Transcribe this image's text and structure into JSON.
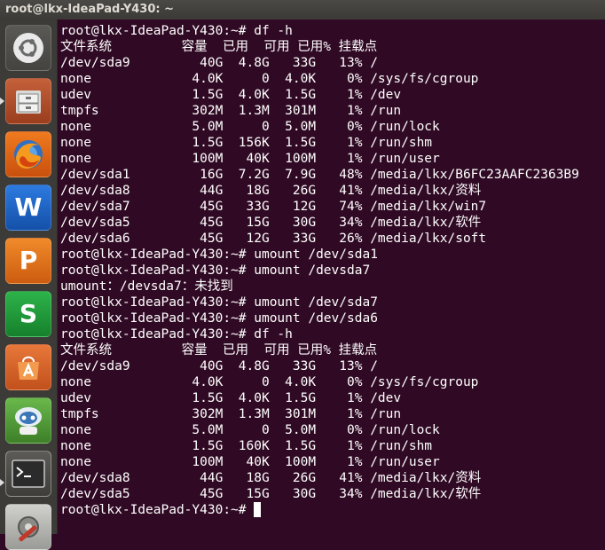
{
  "window": {
    "title": "root@lkx-IdeaPad-Y430: ~"
  },
  "launcher": {
    "items": [
      {
        "name": "ubuntu-dash-icon",
        "color": "#d8d8d8"
      },
      {
        "name": "file-manager-icon",
        "color": "#b5502a"
      },
      {
        "name": "firefox-icon",
        "color": "#e8670f"
      },
      {
        "name": "wps-writer-icon",
        "color": "#1b62c6"
      },
      {
        "name": "wps-presentation-icon",
        "color": "#e4741a"
      },
      {
        "name": "wps-spreadsheets-icon",
        "color": "#219a3a"
      },
      {
        "name": "software-center-icon",
        "color": "#e1672e"
      },
      {
        "name": "robot-app-icon",
        "color": "#4f9a38"
      },
      {
        "name": "terminal-icon",
        "color": "#2d2d2d"
      },
      {
        "name": "system-settings-icon",
        "color": "#c0392b"
      }
    ]
  },
  "terminal": {
    "lines": [
      "root@lkx-IdeaPad-Y430:~# df -h",
      "文件系统         容量  已用  可用 已用% 挂载点",
      "/dev/sda9         40G  4.8G   33G   13% /",
      "none             4.0K     0  4.0K    0% /sys/fs/cgroup",
      "udev             1.5G  4.0K  1.5G    1% /dev",
      "tmpfs            302M  1.3M  301M    1% /run",
      "none             5.0M     0  5.0M    0% /run/lock",
      "none             1.5G  156K  1.5G    1% /run/shm",
      "none             100M   40K  100M    1% /run/user",
      "/dev/sda1         16G  7.2G  7.9G   48% /media/lkx/B6FC23AAFC2363B9",
      "/dev/sda8         44G   18G   26G   41% /media/lkx/资料",
      "/dev/sda7         45G   33G   12G   74% /media/lkx/win7",
      "/dev/sda5         45G   15G   30G   34% /media/lkx/软件",
      "/dev/sda6         45G   12G   33G   26% /media/lkx/soft",
      "root@lkx-IdeaPad-Y430:~# umount /dev/sda1",
      "root@lkx-IdeaPad-Y430:~# umount /devsda7",
      "umount：/devsda7：未找到",
      "root@lkx-IdeaPad-Y430:~# umount /dev/sda7",
      "root@lkx-IdeaPad-Y430:~# umount /dev/sda6",
      "root@lkx-IdeaPad-Y430:~# df -h",
      "文件系统         容量  已用  可用 已用% 挂载点",
      "/dev/sda9         40G  4.8G   33G   13% /",
      "none             4.0K     0  4.0K    0% /sys/fs/cgroup",
      "udev             1.5G  4.0K  1.5G    1% /dev",
      "tmpfs            302M  1.3M  301M    1% /run",
      "none             5.0M     0  5.0M    0% /run/lock",
      "none             1.5G  160K  1.5G    1% /run/shm",
      "none             100M   40K  100M    1% /run/user",
      "/dev/sda8         44G   18G   26G   41% /media/lkx/资料",
      "/dev/sda5         45G   15G   30G   34% /media/lkx/软件"
    ],
    "prompt": "root@lkx-IdeaPad-Y430:~# "
  }
}
